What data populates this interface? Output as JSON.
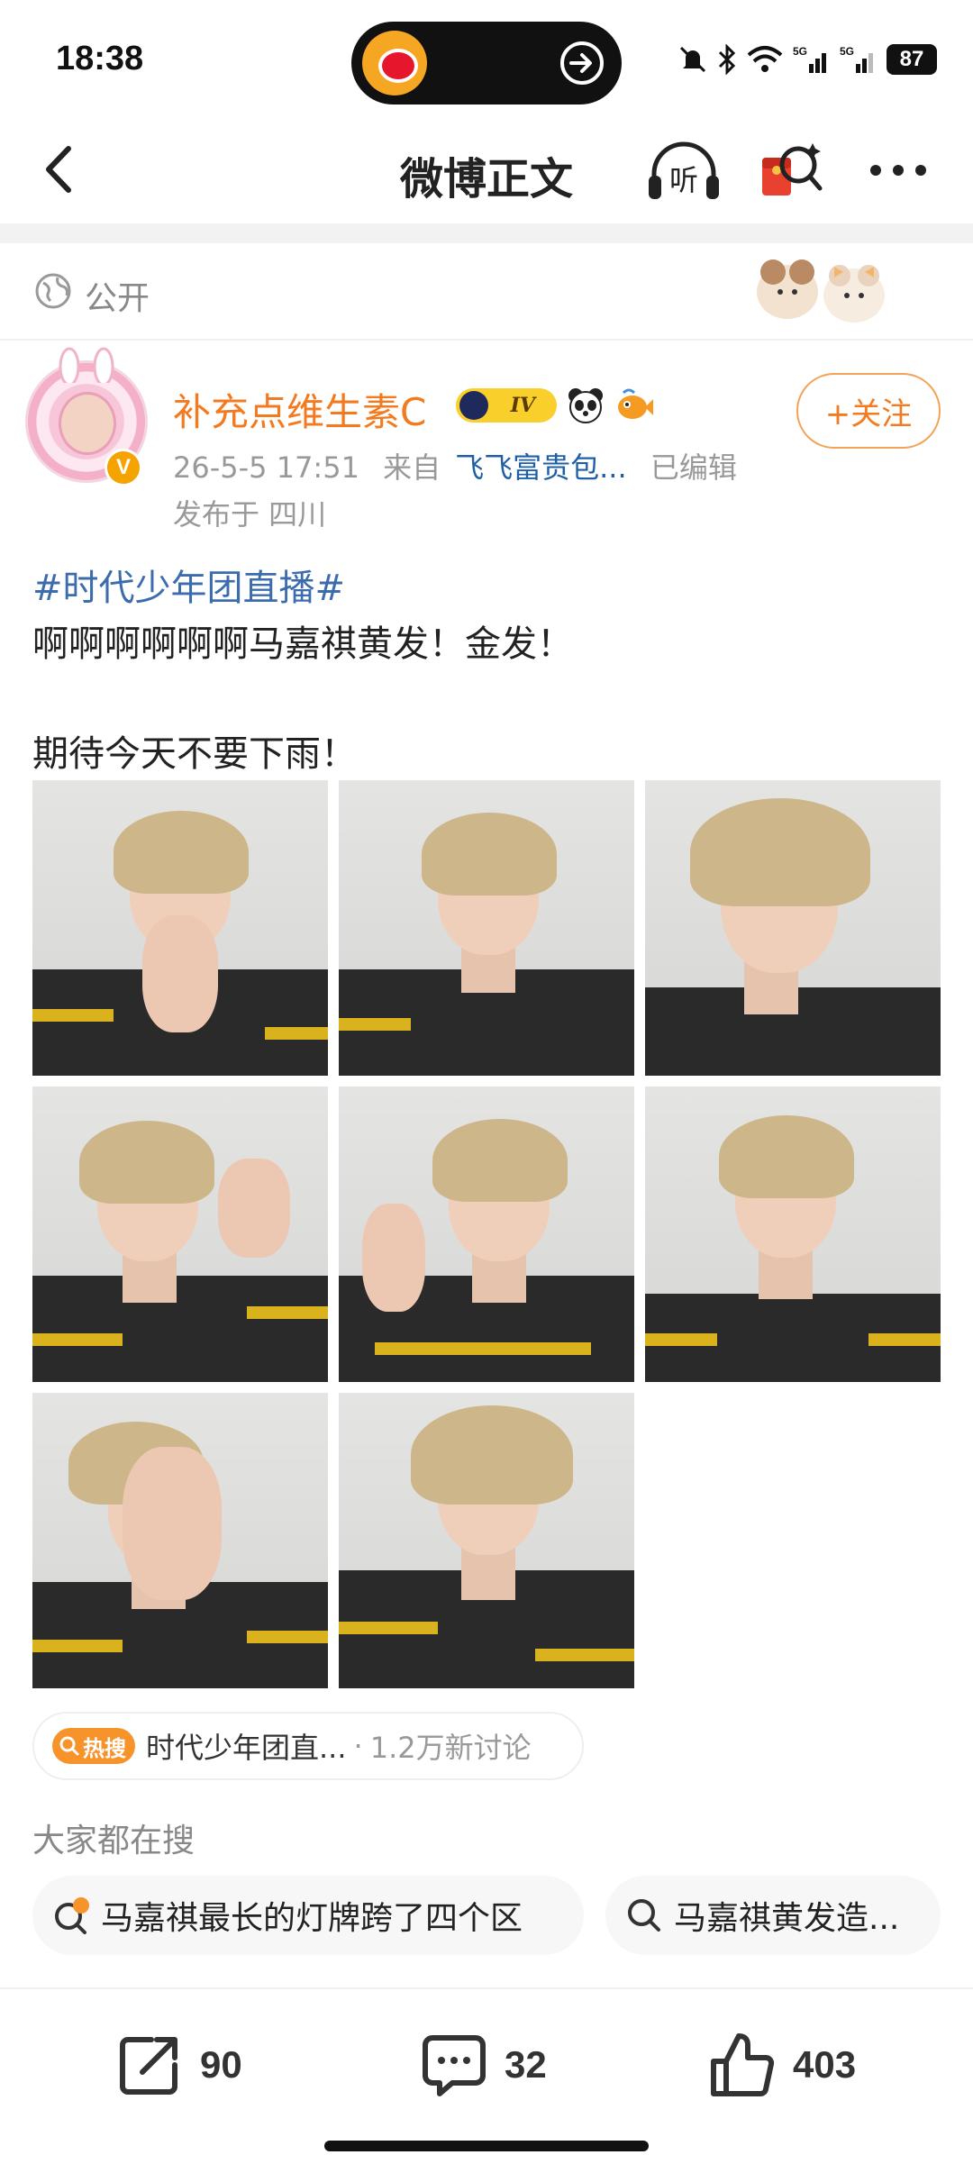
{
  "status_bar": {
    "time": "18:38",
    "battery": "87",
    "icons": [
      "mute-icon",
      "bluetooth-icon",
      "wifi-icon",
      "signal-5g-icon",
      "signal-5g-icon"
    ]
  },
  "nav": {
    "title": "微博正文",
    "listen_label": "听"
  },
  "post": {
    "visibility": "公开",
    "author": {
      "name": "补充点维生素C",
      "level_badge": "IV",
      "verified_mark": "V"
    },
    "follow_label": "+关注",
    "time": "26-5-5 17:51",
    "source_prefix": "来自",
    "source": "飞飞富贵包...",
    "edited": "已编辑",
    "location": "发布于 四川",
    "hashtag": "#时代少年团直播#",
    "lines": [
      "啊啊啊啊啊啊马嘉祺黄发！金发！",
      "",
      "期待今天不要下雨！"
    ],
    "image_count": 8
  },
  "hot_search": {
    "tag": "热搜",
    "topic": "时代少年团直...",
    "dot": "·",
    "discussion": "1.2万新讨论"
  },
  "everyone_searching": {
    "title": "大家都在搜",
    "chips": [
      "马嘉祺最长的灯牌跨了四个区",
      "马嘉祺黄发造..."
    ]
  },
  "actions": {
    "repost_count": "90",
    "comment_count": "32",
    "like_count": "403"
  },
  "colors": {
    "accent_orange": "#f47a1f",
    "link_blue": "#3c6cae",
    "hot_orange": "#f7932b"
  }
}
